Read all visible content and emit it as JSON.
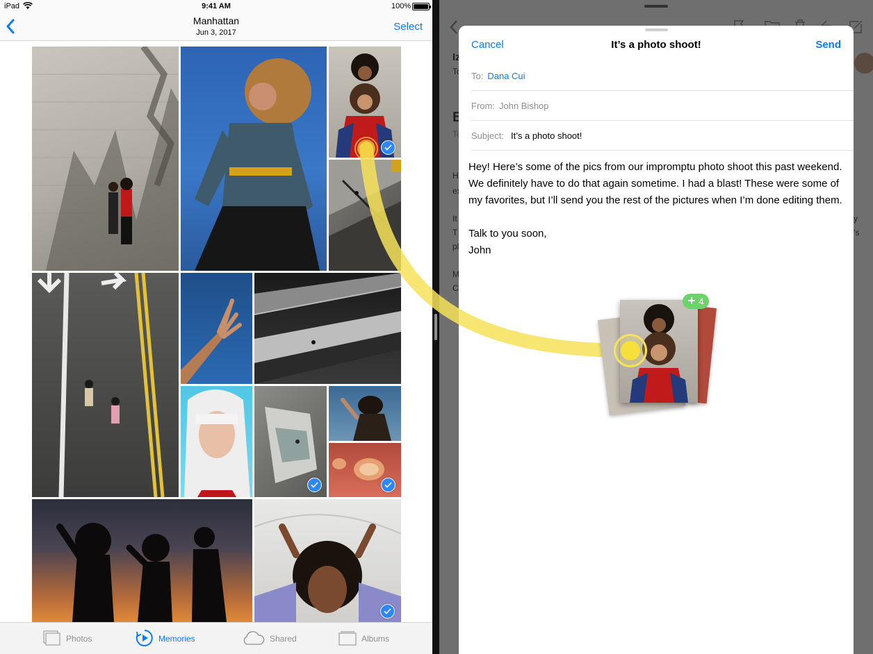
{
  "status_bar": {
    "device": "iPad",
    "time": "9:41 AM",
    "battery": "100%"
  },
  "photos_nav": {
    "title": "Manhattan",
    "date": "Jun 3, 2017",
    "select_label": "Select"
  },
  "tab_bar": {
    "items": [
      {
        "label": "Photos",
        "icon": "photos-icon",
        "active": false
      },
      {
        "label": "Memories",
        "icon": "memories-icon",
        "active": true
      },
      {
        "label": "Shared",
        "icon": "cloud-icon",
        "active": false
      },
      {
        "label": "Albums",
        "icon": "albums-icon",
        "active": false
      }
    ]
  },
  "compose": {
    "cancel_label": "Cancel",
    "title": "It’s a photo shoot!",
    "send_label": "Send",
    "to_label": "To:",
    "to_value": "Dana Cui",
    "from_label": "From:",
    "from_value": "John Bishop",
    "subject_label": "Subject:",
    "subject_value": "It’s a photo shoot!",
    "body_paragraph_1": "Hey! Here’s some of the pics from our impromptu photo shoot this past weekend. We definitely have to do that again sometime. I had a blast! These were some of my favorites, but I’ll send you the rest of the pictures when I’m done editing them.",
    "body_line_2": "Talk to you soon,",
    "body_line_3": "John"
  },
  "drag": {
    "badge_count": "4"
  },
  "colors": {
    "accent": "#0a7aff",
    "check": "#2f86f5",
    "badge": "#6ad36a",
    "drag_path": "#f7e25a"
  }
}
